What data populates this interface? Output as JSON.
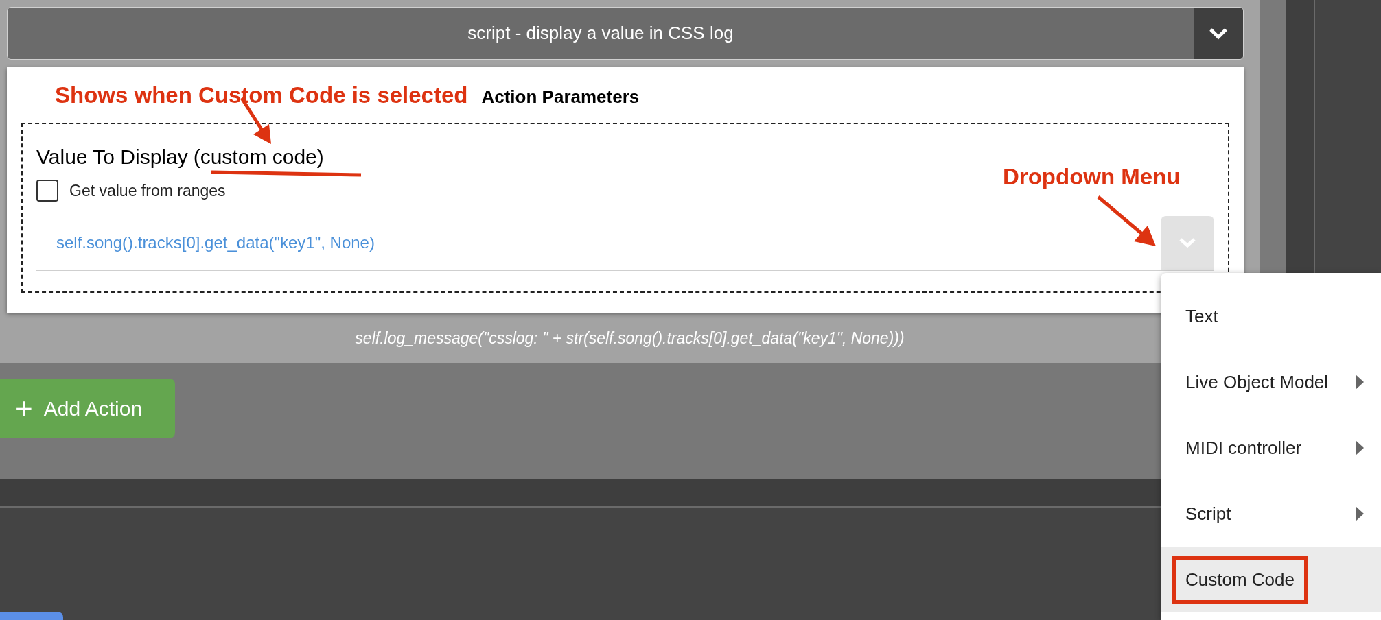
{
  "action_header": {
    "title": "script - display a value in CSS log"
  },
  "annotations": {
    "custom_code_note": "Shows when Custom Code is selected",
    "dropdown_note": "Dropdown Menu"
  },
  "panel": {
    "title": "Action Parameters",
    "field_label": "Value To Display",
    "field_label_suffix": "(custom code)",
    "checkbox": {
      "label": "Get value from ranges",
      "checked": false
    },
    "code_value": "self.song().tracks[0].get_data(\"key1\", None)"
  },
  "preview": "self.log_message(\"csslog: \" + str(self.song().tracks[0].get_data(\"key1\", None)))",
  "add_button": {
    "icon": "+",
    "label": "Add Action"
  },
  "dropdown_menu": {
    "items": [
      {
        "label": "Text",
        "has_submenu": false,
        "selected": false,
        "annotated": false
      },
      {
        "label": "Live Object Model",
        "has_submenu": true,
        "selected": false,
        "annotated": false
      },
      {
        "label": "MIDI controller",
        "has_submenu": true,
        "selected": false,
        "annotated": false
      },
      {
        "label": "Script",
        "has_submenu": true,
        "selected": false,
        "annotated": false
      },
      {
        "label": "Custom Code",
        "has_submenu": false,
        "selected": true,
        "annotated": true
      }
    ]
  }
}
